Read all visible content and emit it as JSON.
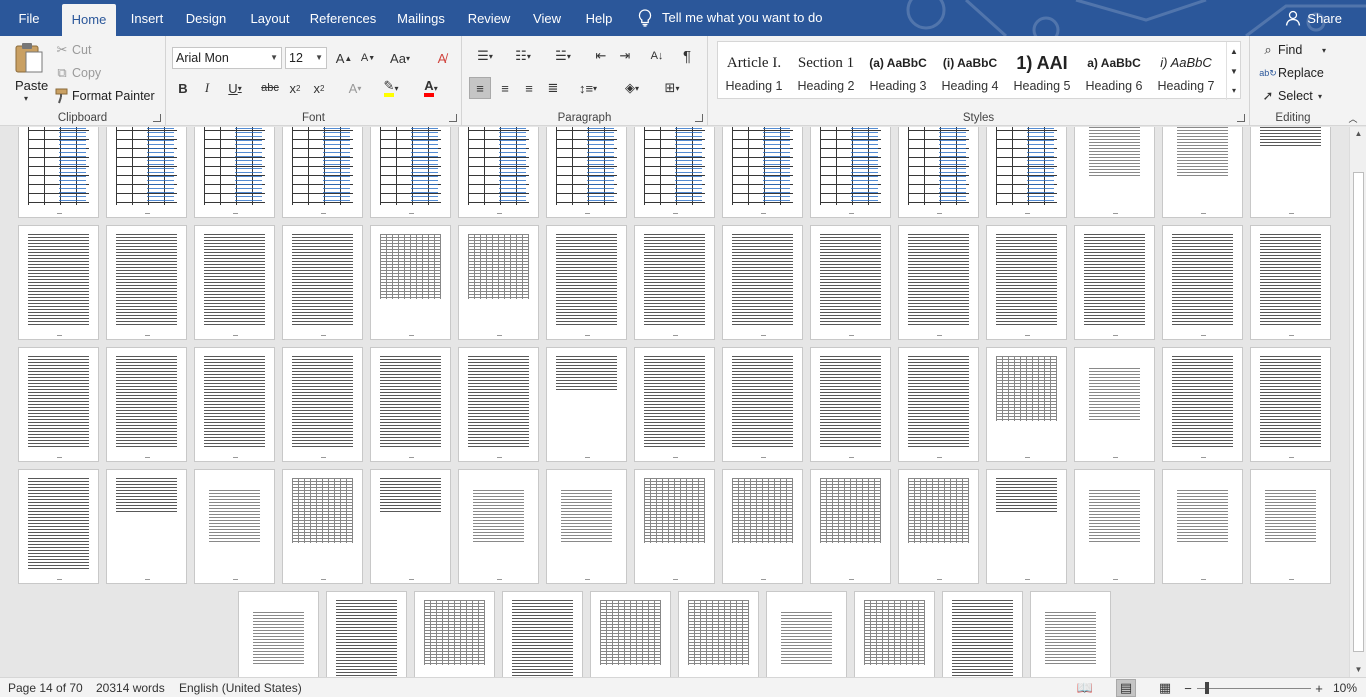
{
  "tabs": [
    {
      "label": "File",
      "active": false
    },
    {
      "label": "Home",
      "active": true
    },
    {
      "label": "Insert",
      "active": false
    },
    {
      "label": "Design",
      "active": false
    },
    {
      "label": "Layout",
      "active": false
    },
    {
      "label": "References",
      "active": false
    },
    {
      "label": "Mailings",
      "active": false
    },
    {
      "label": "Review",
      "active": false
    },
    {
      "label": "View",
      "active": false
    },
    {
      "label": "Help",
      "active": false
    }
  ],
  "tell_me": {
    "icon": "lightbulb-icon",
    "text": "Tell me what you want to do"
  },
  "share": {
    "icon": "person-icon",
    "label": "Share"
  },
  "clipboard": {
    "label": "Clipboard",
    "paste": "Paste",
    "cut": "Cut",
    "copy": "Copy",
    "format_painter": "Format Painter"
  },
  "font": {
    "label": "Font",
    "font_name": "Arial Mon",
    "font_size": "12"
  },
  "paragraph": {
    "label": "Paragraph"
  },
  "styles": {
    "label": "Styles",
    "items": [
      {
        "preview": "Article I.",
        "label": "Heading 1"
      },
      {
        "preview": "Section 1",
        "label": "Heading 2"
      },
      {
        "preview": "(a) AaBbC",
        "label": "Heading 3"
      },
      {
        "preview": "(i) AaBbC",
        "label": "Heading 4"
      },
      {
        "preview": "1) AAI",
        "label": "Heading 5"
      },
      {
        "preview": "a) AaBbC",
        "label": "Heading 6"
      },
      {
        "preview": "i) AaBbC",
        "label": "Heading 7"
      }
    ]
  },
  "editing": {
    "label": "Editing",
    "find": "Find",
    "replace": "Replace",
    "select": "Select"
  },
  "status": {
    "page": "Page 14 of 70",
    "words": "20314 words",
    "language": "English (United States)",
    "zoom": "10%"
  },
  "colors": {
    "accent": "#2b579a",
    "highlight": "#ffff00",
    "font_color": "#ff0000"
  }
}
